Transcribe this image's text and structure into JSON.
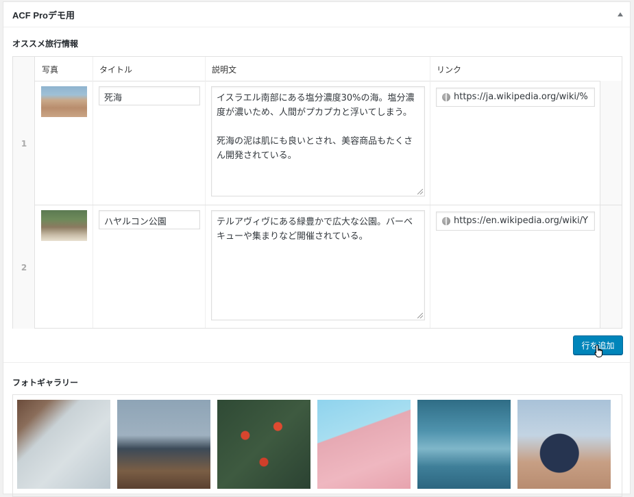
{
  "metabox": {
    "title": "ACF Proデモ用"
  },
  "repeater": {
    "label": "オススメ旅行情報",
    "columns": [
      "写真",
      "タイトル",
      "説明文",
      "リンク"
    ],
    "rows": [
      {
        "order": "1",
        "title": "死海",
        "description": "イスラエル南部にある塩分濃度30%の海。塩分濃度が濃いため、人間がプカプカと浮いてしまう。\n\n死海の泥は肌にも良いとされ、美容商品もたくさん開発されている。",
        "link": "https://ja.wikipedia.org/wiki/%"
      },
      {
        "order": "2",
        "title": "ハヤルコン公園",
        "description": "テルアヴィヴにある緑豊かで広大な公園。バーベキューや集まりなど開催されている。",
        "link": "https://en.wikipedia.org/wiki/Y"
      }
    ],
    "add_row_label": "行を追加"
  },
  "gallery": {
    "label": "フォトギャラリー"
  },
  "colors": {
    "primary_button": "#0085ba",
    "border": "#e1e1e1"
  }
}
